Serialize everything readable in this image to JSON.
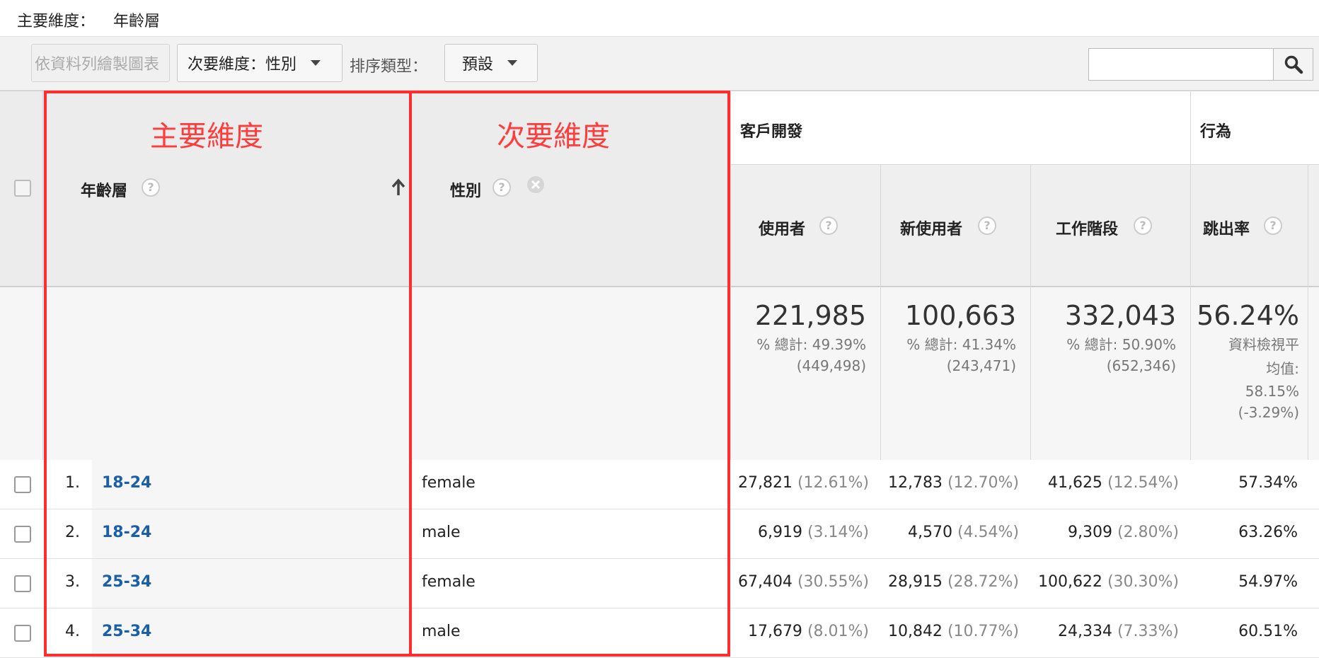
{
  "topbar": {
    "primary_label": "主要維度：",
    "primary_value": "年齡層"
  },
  "toolbar": {
    "plot_rows_label": "依資料列繪製圖表",
    "secondary_dim_label": "次要維度：性別",
    "sort_type_label": "排序類型：",
    "sort_value": "預設",
    "search_placeholder": ""
  },
  "annotations": {
    "primary": "主要維度",
    "secondary": "次要維度"
  },
  "columns": {
    "group_acquisition": "客戶開發",
    "group_behavior": "行為",
    "age": "年齡層",
    "gender": "性別",
    "users": "使用者",
    "new_users": "新使用者",
    "sessions": "工作階段",
    "bounce_rate": "跳出率",
    "help": "?"
  },
  "totals": {
    "users": {
      "value": "221,985",
      "pct": "% 總計: 49.39%",
      "base": "(449,498)"
    },
    "new_users": {
      "value": "100,663",
      "pct": "% 總計: 41.34%",
      "base": "(243,471)"
    },
    "sessions": {
      "value": "332,043",
      "pct": "% 總計: 50.90%",
      "base": "(652,346)"
    },
    "bounce_rate": {
      "value": "56.24%",
      "l1": "資料檢視平",
      "l2": "均值:",
      "l3": "58.15%",
      "l4": "(-3.29%)"
    }
  },
  "rows": [
    {
      "num": "1.",
      "age": "18-24",
      "gender": "female",
      "users": "27,821",
      "users_pct": "(12.61%)",
      "new_users": "12,783",
      "new_users_pct": "(12.70%)",
      "sessions": "41,625",
      "sessions_pct": "(12.54%)",
      "bounce": "57.34%"
    },
    {
      "num": "2.",
      "age": "18-24",
      "gender": "male",
      "users": "6,919",
      "users_pct": "(3.14%)",
      "new_users": "4,570",
      "new_users_pct": "(4.54%)",
      "sessions": "9,309",
      "sessions_pct": "(2.80%)",
      "bounce": "63.26%"
    },
    {
      "num": "3.",
      "age": "25-34",
      "gender": "female",
      "users": "67,404",
      "users_pct": "(30.55%)",
      "new_users": "28,915",
      "new_users_pct": "(28.72%)",
      "sessions": "100,622",
      "sessions_pct": "(30.30%)",
      "bounce": "54.97%"
    },
    {
      "num": "4.",
      "age": "25-34",
      "gender": "male",
      "users": "17,679",
      "users_pct": "(8.01%)",
      "new_users": "10,842",
      "new_users_pct": "(10.77%)",
      "sessions": "24,334",
      "sessions_pct": "(7.33%)",
      "bounce": "60.51%"
    }
  ],
  "colors": {
    "annotation_red": "#ff2d2d",
    "link_blue": "#1a5fa8"
  }
}
